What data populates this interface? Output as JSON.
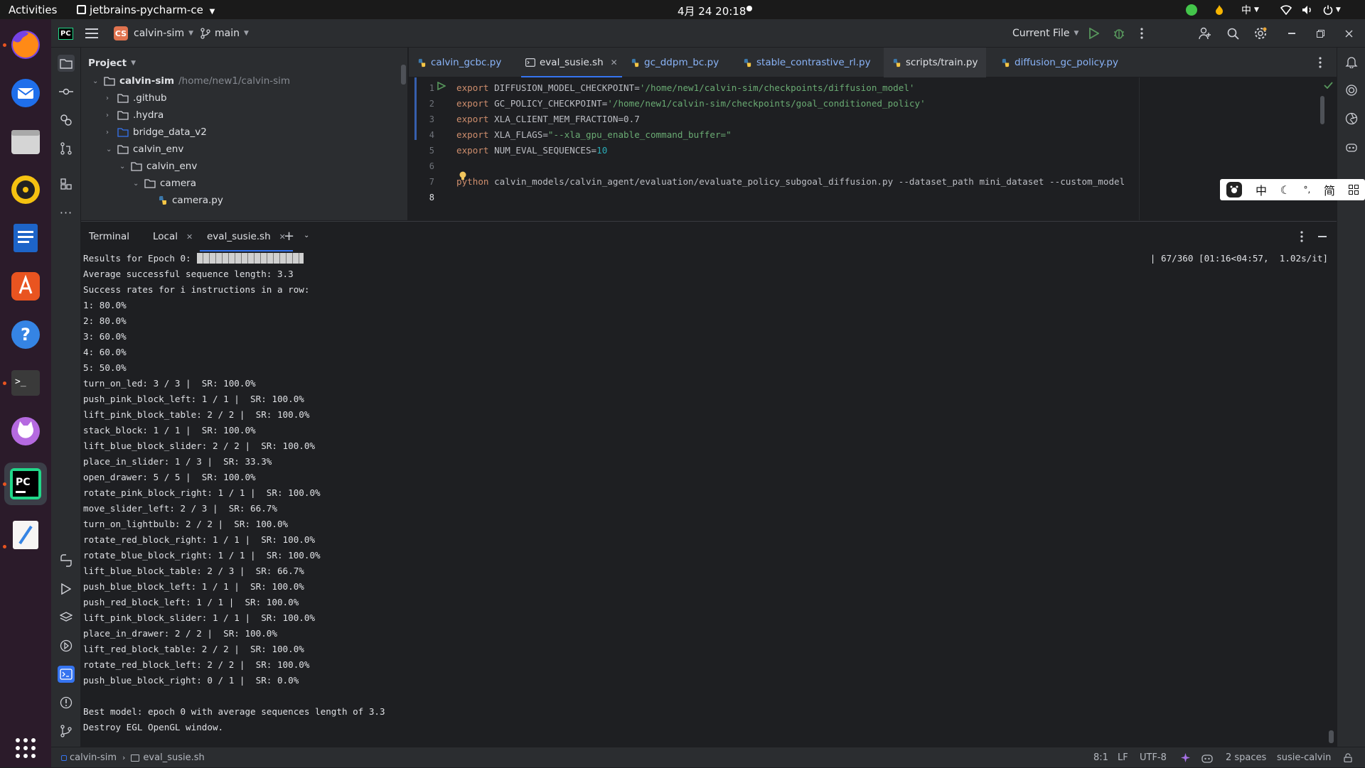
{
  "topbar": {
    "activities": "Activities",
    "app_menu": "jetbrains-pycharm-ce",
    "clock": "4月 24 20:18",
    "ime_label": "中"
  },
  "ide": {
    "logo": "PC",
    "project_badge": "CS",
    "project_name": "calvin-sim",
    "branch": "main",
    "run_config": "Current File"
  },
  "project_panel": {
    "title": "Project",
    "tree": [
      {
        "label": "calvin-sim",
        "sub": "/home/new1/calvin-sim",
        "type": "root"
      },
      {
        "label": ".github",
        "type": "folder"
      },
      {
        "label": ".hydra",
        "type": "folder"
      },
      {
        "label": "bridge_data_v2",
        "type": "module"
      },
      {
        "label": "calvin_env",
        "type": "folder-open"
      },
      {
        "label": "calvin_env",
        "type": "folder-open"
      },
      {
        "label": "camera",
        "type": "folder-open"
      },
      {
        "label": "camera.py",
        "type": "python"
      }
    ]
  },
  "editor": {
    "tabs": [
      {
        "label": "calvin_gcbc.py"
      },
      {
        "label": "eval_susie.sh",
        "active": true
      },
      {
        "label": "gc_ddpm_bc.py"
      },
      {
        "label": "stable_contrastive_rl.py"
      },
      {
        "label": "scripts/train.py"
      },
      {
        "label": "diffusion_gc_policy.py"
      }
    ],
    "lines": [
      {
        "n": "1",
        "kw": "export",
        "name": " DIFFUSION_MODEL_CHECKPOINT=",
        "val": "'/home/new1/calvin-sim/checkpoints/diffusion_model'",
        "vt": "str"
      },
      {
        "n": "2",
        "kw": "export",
        "name": " GC_POLICY_CHECKPOINT=",
        "val": "'/home/new1/calvin-sim/checkpoints/goal_conditioned_policy'",
        "vt": "str"
      },
      {
        "n": "3",
        "kw": "export",
        "name": " XLA_CLIENT_MEM_FRACTION=0.7",
        "val": "",
        "vt": "plain"
      },
      {
        "n": "4",
        "kw": "export",
        "name": " XLA_FLAGS=",
        "val": "\"--xla_gpu_enable_command_buffer=\"",
        "vt": "str"
      },
      {
        "n": "5",
        "kw": "export",
        "name": " NUM_EVAL_SEQUENCES=",
        "val": "10",
        "vt": "num"
      },
      {
        "n": "6",
        "kw": "",
        "name": "",
        "val": "",
        "vt": "plain"
      },
      {
        "n": "7",
        "kw": "python",
        "name": " calvin_models/calvin_agent/evaluation/evaluate_policy_subgoal_diffusion.py --dataset_path mini_dataset --custom_model",
        "val": "",
        "vt": "plain"
      },
      {
        "n": "8",
        "kw": "",
        "name": "",
        "val": "",
        "vt": "plain"
      }
    ]
  },
  "terminal": {
    "title": "Terminal",
    "tabs": [
      {
        "label": "Local"
      },
      {
        "label": "eval_susie.sh",
        "active": true
      }
    ],
    "progress_text": "| 67/360 [01:16<04:57,  1.02s/it]",
    "lines": [
      "Results for Epoch 0:",
      "Average successful sequence length: 3.3",
      "Success rates for i instructions in a row:",
      "1: 80.0%",
      "2: 80.0%",
      "3: 60.0%",
      "4: 60.0%",
      "5: 50.0%",
      "turn_on_led: 3 / 3 |  SR: 100.0%",
      "push_pink_block_left: 1 / 1 |  SR: 100.0%",
      "lift_pink_block_table: 2 / 2 |  SR: 100.0%",
      "stack_block: 1 / 1 |  SR: 100.0%",
      "lift_blue_block_slider: 2 / 2 |  SR: 100.0%",
      "place_in_slider: 1 / 3 |  SR: 33.3%",
      "open_drawer: 5 / 5 |  SR: 100.0%",
      "rotate_pink_block_right: 1 / 1 |  SR: 100.0%",
      "move_slider_left: 2 / 3 |  SR: 66.7%",
      "turn_on_lightbulb: 2 / 2 |  SR: 100.0%",
      "rotate_red_block_right: 1 / 1 |  SR: 100.0%",
      "rotate_blue_block_right: 1 / 1 |  SR: 100.0%",
      "lift_blue_block_table: 2 / 3 |  SR: 66.7%",
      "push_blue_block_left: 1 / 1 |  SR: 100.0%",
      "push_red_block_left: 1 / 1 |  SR: 100.0%",
      "lift_pink_block_slider: 1 / 1 |  SR: 100.0%",
      "place_in_drawer: 2 / 2 |  SR: 100.0%",
      "lift_red_block_table: 2 / 2 |  SR: 100.0%",
      "rotate_red_block_left: 2 / 2 |  SR: 100.0%",
      "push_blue_block_right: 0 / 1 |  SR: 0.0%",
      "",
      "Best model: epoch 0 with average sequences length of 3.3",
      "Destroy EGL OpenGL window."
    ]
  },
  "statusbar": {
    "breadcrumb_project": "calvin-sim",
    "breadcrumb_file": "eval_susie.sh",
    "position": "8:1",
    "line_sep": "LF",
    "encoding": "UTF-8",
    "indent": "2 spaces",
    "interpreter": "susie-calvin"
  },
  "ime_toolbar": {
    "mode": "中",
    "punct": "°,",
    "charset": "简"
  },
  "colors": {
    "accent": "#3574f0",
    "keyword": "#cf8e6d",
    "string": "#6aab73",
    "number": "#2aacb8",
    "run_green": "#57965c",
    "project_badge": "#e0734f"
  }
}
